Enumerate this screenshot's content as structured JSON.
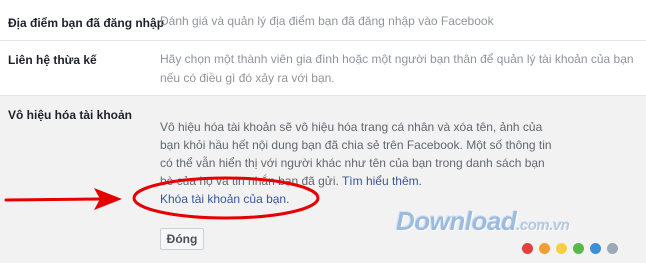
{
  "settings": {
    "rows": [
      {
        "label": "Địa điểm bạn đã đăng nhập",
        "description": "Đánh giá và quản lý địa điểm bạn đã đăng nhập vào Facebook"
      },
      {
        "label": "Liên hệ thừa kế",
        "description_lines": [
          "Hãy chọn một thành viên gia đình hoặc một người bạn thân để quản lý tài khoản của bạn",
          "nếu có điều gì đó xảy ra với bạn."
        ]
      }
    ],
    "deactivate": {
      "label": "Vô hiệu hóa tài khoản",
      "description_lines": [
        "Vô hiệu hóa tài khoản sẽ vô hiệu hóa trang cá nhân và xóa tên, ảnh của",
        "bạn khỏi hầu hết nội dung bạn đã chia sẻ trên Facebook. Một số thông tin",
        "có thể vẫn hiển thị với người khác như tên của bạn trong danh sách bạn",
        "bè của họ và tin nhắn bạn đã gửi. "
      ],
      "learn_more": "Tìm hiểu thêm.",
      "deactivate_link": "Khóa tài khoản của bạn.",
      "close_button": "Đóng"
    }
  },
  "watermark": {
    "text": "Download",
    "suffix": ".com.vn",
    "dot_colors": [
      "#e24040",
      "#f0a030",
      "#f5d040",
      "#58b848",
      "#3a8fd8",
      "#9aa8b8"
    ]
  },
  "annotation": {
    "arrow_color": "#e60000",
    "ellipse_color": "#e60000"
  }
}
